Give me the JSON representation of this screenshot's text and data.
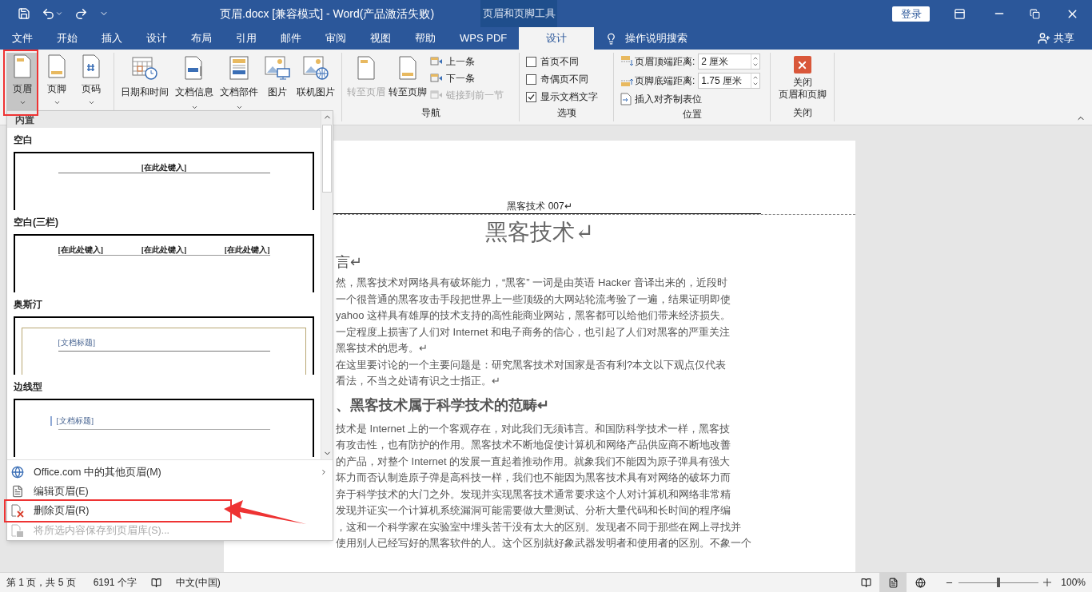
{
  "title_bar": {
    "title": "页眉.docx [兼容模式]  -  Word(产品激活失败)",
    "context_group": "页眉和页脚工具",
    "login": "登录"
  },
  "tabs": [
    {
      "label": "文件",
      "selected": false
    },
    {
      "label": "开始",
      "selected": false
    },
    {
      "label": "插入",
      "selected": false
    },
    {
      "label": "设计",
      "selected": false
    },
    {
      "label": "布局",
      "selected": false
    },
    {
      "label": "引用",
      "selected": false
    },
    {
      "label": "邮件",
      "selected": false
    },
    {
      "label": "审阅",
      "selected": false
    },
    {
      "label": "视图",
      "selected": false
    },
    {
      "label": "帮助",
      "selected": false
    },
    {
      "label": "WPS PDF",
      "selected": false
    },
    {
      "label": "设计",
      "selected": true
    }
  ],
  "tell_me": "操作说明搜索",
  "share": "共享",
  "ribbon": {
    "header_footer": [
      {
        "label": "页眉",
        "pressed": true
      },
      {
        "label": "页脚",
        "pressed": false
      },
      {
        "label": "页码",
        "pressed": false
      }
    ],
    "insert": [
      {
        "label": "日期和时间",
        "kind": "date",
        "dropdown": false
      },
      {
        "label": "文档信息",
        "kind": "info",
        "dropdown": true
      },
      {
        "label": "文档部件",
        "kind": "parts",
        "dropdown": true
      },
      {
        "label": "图片",
        "kind": "picture",
        "dropdown": false
      },
      {
        "label": "联机图片",
        "kind": "online",
        "dropdown": false
      }
    ],
    "navigation": {
      "label": "导航",
      "large": [
        {
          "label": "转至页眉",
          "disabled": true
        },
        {
          "label": "转至页脚",
          "disabled": false
        }
      ],
      "small": [
        {
          "label": "上一条",
          "disabled": false
        },
        {
          "label": "下一条",
          "disabled": false
        },
        {
          "label": "链接到前一节",
          "disabled": true
        }
      ]
    },
    "options": {
      "label": "选项",
      "checkboxes": [
        {
          "label": "首页不同",
          "checked": false
        },
        {
          "label": "奇偶页不同",
          "checked": false
        },
        {
          "label": "显示文档文字",
          "checked": true
        }
      ]
    },
    "position": {
      "label": "位置",
      "fields": [
        {
          "label": "页眉顶端距离:",
          "value": "2 厘米"
        },
        {
          "label": "页脚底端距离:",
          "value": "1.75 厘米"
        }
      ],
      "tab_button": "插入对齐制表位"
    },
    "close": {
      "label": "关闭",
      "button": [
        "关闭",
        "页眉和页脚"
      ]
    }
  },
  "dropdown": {
    "section": "内置",
    "gallery": [
      {
        "name": "空白",
        "kind": "single",
        "placeholders": [
          "[在此处键入]"
        ]
      },
      {
        "name": "空白(三栏)",
        "kind": "three",
        "placeholders": [
          "[在此处键入]",
          "[在此处键入]",
          "[在此处键入]"
        ]
      },
      {
        "name": "奥斯汀",
        "kind": "framed",
        "placeholders": [
          "[文档标题]"
        ]
      },
      {
        "name": "边线型",
        "kind": "sideline",
        "placeholders": [
          "[文档标题]"
        ]
      }
    ],
    "menu": [
      {
        "label": "Office.com 中的其他页眉(M)",
        "kind": "web",
        "submenu": true,
        "disabled": false
      },
      {
        "label": "编辑页眉(E)",
        "kind": "edit",
        "submenu": false,
        "disabled": false
      },
      {
        "label": "删除页眉(R)",
        "kind": "remove",
        "submenu": false,
        "disabled": false,
        "highlighted": true
      },
      {
        "label": "将所选内容保存到页眉库(S)...",
        "kind": "save",
        "submenu": false,
        "disabled": true
      }
    ]
  },
  "document": {
    "header_text": "黑客技术 007↵",
    "title": "黑客技术↵",
    "blocks": [
      {
        "kind": "heading",
        "text": "言↵"
      },
      {
        "kind": "para",
        "lines": [
          "然，黑客技术对网络具有破坏能力，“黑客” 一词是由英语 Hacker 音译出来的，近段时",
          "一个很普通的黑客攻击手段把世界上一些顶级的大网站轮流考验了一遍，结果证明即使",
          "yahoo 这样具有雄厚的技术支持的高性能商业网站，黑客都可以给他们带来经济损失。",
          "一定程度上损害了人们对 Internet 和电子商务的信心，也引起了人们对黑客的严重关注",
          "黑客技术的思考。↵",
          "在这里要讨论的一个主要问题是：研究黑客技术对国家是否有利?本文以下观点仅代表",
          "看法，不当之处请有识之士指正。↵"
        ]
      },
      {
        "kind": "heading",
        "text": "、黑客技术属于科学技术的范畴↵"
      },
      {
        "kind": "para",
        "lines": [
          "技术是 Internet 上的一个客观存在，对此我们无须讳言。和国防科学技术一样，黑客技",
          "有攻击性，也有防护的作用。黑客技术不断地促使计算机和网络产品供应商不断地改善",
          "的产品，对整个 Internet 的发展一直起着推动作用。就象我们不能因为原子弹具有强大",
          "坏力而否认制造原子弹是高科技一样，我们也不能因为黑客技术具有对网络的破坏力而",
          "弃于科学技术的大门之外。发现并实现黑客技术通常要求这个人对计算机和网络非常精",
          "发现并证实一个计算机系统漏洞可能需要做大量测试、分析大量代码和长时间的程序编",
          "，这和一个科学家在实验室中埋头苦干没有太大的区别。发现者不同于那些在网上寻找并",
          "使用别人已经写好的黑客软件的人。这个区别就好象武器发明者和使用者的区别。不象一个"
        ]
      }
    ]
  },
  "status_bar": {
    "page": "第 1 页，共 5 页",
    "words": "6191 个字",
    "language": "中文(中国)",
    "views": [
      {
        "kind": "read",
        "selected": false
      },
      {
        "kind": "print",
        "selected": true
      },
      {
        "kind": "web",
        "selected": false
      }
    ],
    "zoom": {
      "level": 0.5,
      "reading": "100%"
    }
  }
}
